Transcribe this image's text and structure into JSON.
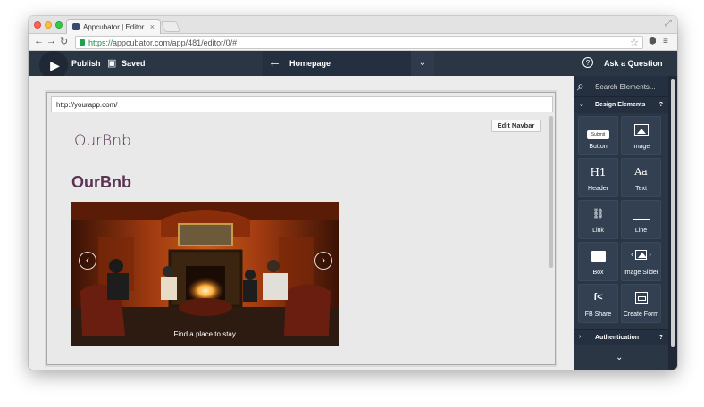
{
  "browser": {
    "tab_title": "Appcubator | Editor",
    "url_secure": "https://",
    "url_rest": "appcubator.com/app/481/editor/0/#"
  },
  "toolbar": {
    "publish_label": "Publish",
    "saved_label": "Saved",
    "page_name": "Homepage",
    "ask_label": "Ask a Question"
  },
  "canvas": {
    "device_url": "http://yourapp.com/",
    "edit_navbar_label": "Edit Navbar",
    "nav_logo": "OurBnb",
    "hero_title": "OurBnb",
    "slider_caption": "Find a place to stay."
  },
  "sidebar": {
    "search_placeholder": "Search Elements...",
    "design_section": "Design Elements",
    "auth_section": "Authentication",
    "help_mark": "?",
    "elements": [
      {
        "label": "Button",
        "icon": "button-icon"
      },
      {
        "label": "Image",
        "icon": "image-icon"
      },
      {
        "label": "Header",
        "icon": "header-icon"
      },
      {
        "label": "Text",
        "icon": "text-icon"
      },
      {
        "label": "Link",
        "icon": "link-icon"
      },
      {
        "label": "Line",
        "icon": "line-icon"
      },
      {
        "label": "Box",
        "icon": "box-icon"
      },
      {
        "label": "Image Slider",
        "icon": "image-slider-icon"
      },
      {
        "label": "FB Share",
        "icon": "fb-share-icon"
      },
      {
        "label": "Create Form",
        "icon": "create-form-icon"
      }
    ],
    "button_chip": "Submit",
    "header_glyph": "H1",
    "text_glyph": "Aa"
  },
  "colors": {
    "toolbar_bg": "#2b3645",
    "brand_purple": "#5c3354"
  }
}
